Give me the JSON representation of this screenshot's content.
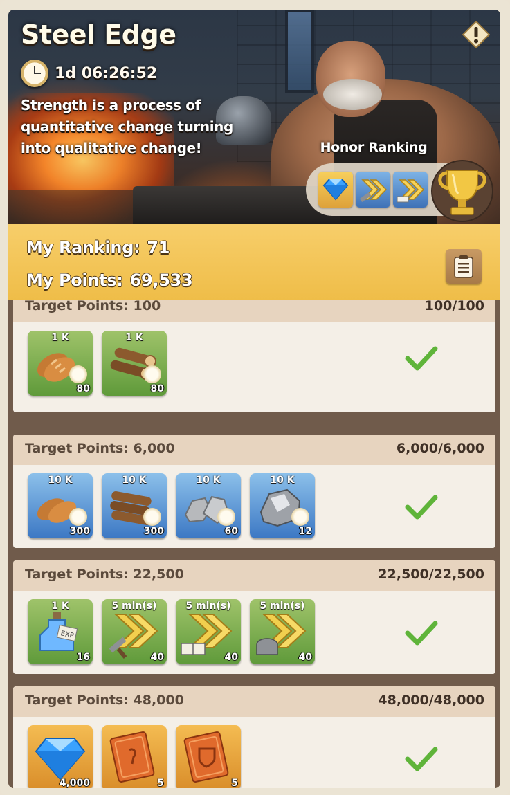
{
  "event": {
    "title": "Steel Edge",
    "timer": "1d 06:26:52",
    "description": "Strength is a process of quantitative change turning into qualitative change!",
    "honor_ranking_label": "Honor Ranking"
  },
  "stats": {
    "ranking_label": "My Ranking:",
    "ranking_value": "71",
    "points_label": "My Points:",
    "points_value": "69,533"
  },
  "icons": {
    "alert": "alert-diamond-icon",
    "clock": "clock-icon",
    "clipboard": "clipboard-icon",
    "trophy": "trophy-icon",
    "check": "checkmark-icon"
  },
  "colors": {
    "stats_bg": "#efbd48",
    "card_header": "#e7d4bf",
    "check_green": "#5fb43a",
    "rarity_green": "#6aa43f",
    "rarity_blue": "#3c78c4",
    "rarity_gold": "#d98d2a"
  },
  "milestones": [
    {
      "label": "Target Points: 100",
      "progress": "100/100",
      "completed": true,
      "rewards": [
        {
          "name": "bread",
          "top": "1 K",
          "qty": "80",
          "rarity": "green"
        },
        {
          "name": "wood",
          "top": "1 K",
          "qty": "80",
          "rarity": "green"
        }
      ]
    },
    {
      "label": "Target Points: 6,000",
      "progress": "6,000/6,000",
      "completed": true,
      "rewards": [
        {
          "name": "bread",
          "top": "10 K",
          "qty": "300",
          "rarity": "blue"
        },
        {
          "name": "wood",
          "top": "10 K",
          "qty": "300",
          "rarity": "blue"
        },
        {
          "name": "stone",
          "top": "10 K",
          "qty": "60",
          "rarity": "blue"
        },
        {
          "name": "iron",
          "top": "10 K",
          "qty": "12",
          "rarity": "blue"
        }
      ]
    },
    {
      "label": "Target Points: 22,500",
      "progress": "22,500/22,500",
      "completed": true,
      "rewards": [
        {
          "name": "exp-potion",
          "top": "1 K",
          "qty": "16",
          "rarity": "green"
        },
        {
          "name": "speedup-building",
          "top": "5 min(s)",
          "qty": "40",
          "rarity": "green"
        },
        {
          "name": "speedup-research",
          "top": "5 min(s)",
          "qty": "40",
          "rarity": "green"
        },
        {
          "name": "speedup-training",
          "top": "5 min(s)",
          "qty": "40",
          "rarity": "green"
        }
      ]
    },
    {
      "label": "Target Points: 48,000",
      "progress": "48,000/48,000",
      "completed": true,
      "rewards": [
        {
          "name": "gem",
          "top": "",
          "qty": "4,000",
          "rarity": "gold"
        },
        {
          "name": "tome-a",
          "top": "",
          "qty": "5",
          "rarity": "gold"
        },
        {
          "name": "tome-b",
          "top": "",
          "qty": "5",
          "rarity": "gold"
        }
      ]
    }
  ]
}
